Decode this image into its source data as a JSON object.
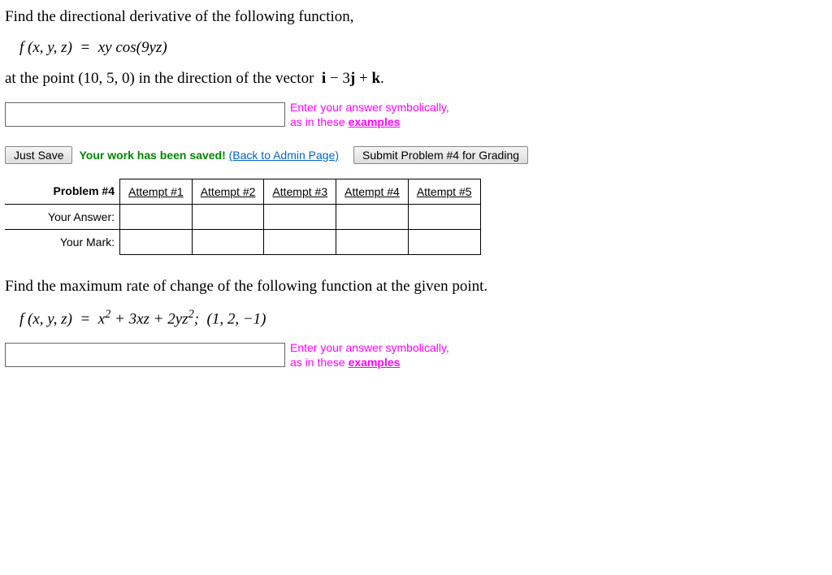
{
  "problem4": {
    "intro": "Find the directional derivative of the following function,",
    "equation_html": "f (x, y, z)&nbsp; =&nbsp; xy cos(9yz)",
    "tail": "at the point (10, 5, 0) in the direction of the vector  i − 3j + k.",
    "hint_line1": "Enter your answer symbolically,",
    "hint_line2_prefix": "as in these ",
    "hint_link": "examples"
  },
  "actions": {
    "just_save": "Just Save",
    "saved_msg": "Your work has been saved!",
    "back_link": "(Back to Admin Page)",
    "submit": "Submit Problem #4 for Grading"
  },
  "attempts_table": {
    "problem_label": "Problem #4",
    "row_labels": [
      "Your Answer:",
      "Your Mark:"
    ],
    "headers": [
      "Attempt #1",
      "Attempt #2",
      "Attempt #3",
      "Attempt #4",
      "Attempt #5"
    ]
  },
  "problem5": {
    "intro": "Find the maximum rate of change of the following function at the given point.",
    "equation_html": "f (x, y, z)&nbsp; =&nbsp; x<span class='sup'>2</span> + 3xz + 2yz<span class='sup'>2</span>;&nbsp;&nbsp;(1, 2, −1)",
    "hint_line1": "Enter your answer symbolically,",
    "hint_line2_prefix": "as in these ",
    "hint_link": "examples"
  }
}
